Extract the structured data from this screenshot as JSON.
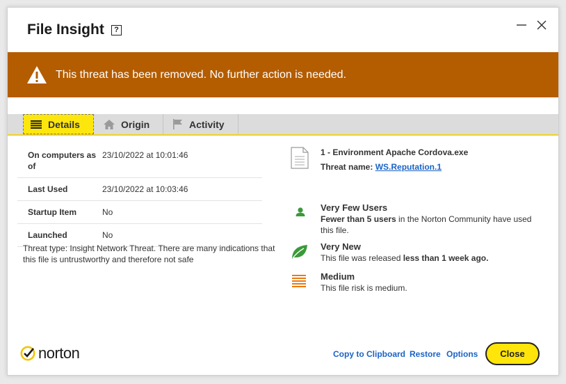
{
  "window": {
    "title": "File Insight",
    "help_label": "?"
  },
  "banner": {
    "message": "This threat has been removed. No further action is needed.",
    "color": "#b45c00"
  },
  "tabs": [
    {
      "label": "Details",
      "icon": "list-icon",
      "active": true
    },
    {
      "label": "Origin",
      "icon": "home-icon",
      "active": false
    },
    {
      "label": "Activity",
      "icon": "flag-icon",
      "active": false
    }
  ],
  "details": {
    "rows": [
      {
        "label": "On computers as of",
        "value": "23/10/2022 at 10:01:46"
      },
      {
        "label": "Last Used",
        "value": "23/10/2022 at 10:03:46"
      },
      {
        "label": "Startup Item",
        "value": "No"
      },
      {
        "label": "Launched",
        "value": "No"
      }
    ],
    "threat_type": "Threat type: Insight Network Threat. There are many indications that this file is untrustworthy and therefore not safe"
  },
  "file": {
    "name": "1 - Environment Apache Cordova.exe",
    "threat_label": "Threat name: ",
    "threat_name": "WS.Reputation.1"
  },
  "insights": {
    "users": {
      "title": "Very Few Users",
      "desc_bold": "Fewer than 5 users",
      "desc_rest": " in the Norton Community have used this file.",
      "color": "#3a9a3a"
    },
    "age": {
      "title": "Very New",
      "desc_start": "This file was released ",
      "desc_bold": "less than 1 week ago.",
      "color": "#3a9a3a"
    },
    "risk": {
      "title": "Medium",
      "desc": "This file risk is medium.",
      "color": "#e87a10"
    }
  },
  "footer": {
    "brand": "norton",
    "copy_label": "Copy to Clipboard",
    "restore_label": "Restore",
    "options_label": "Options",
    "close_label": "Close",
    "accent": "#ffe50a"
  }
}
